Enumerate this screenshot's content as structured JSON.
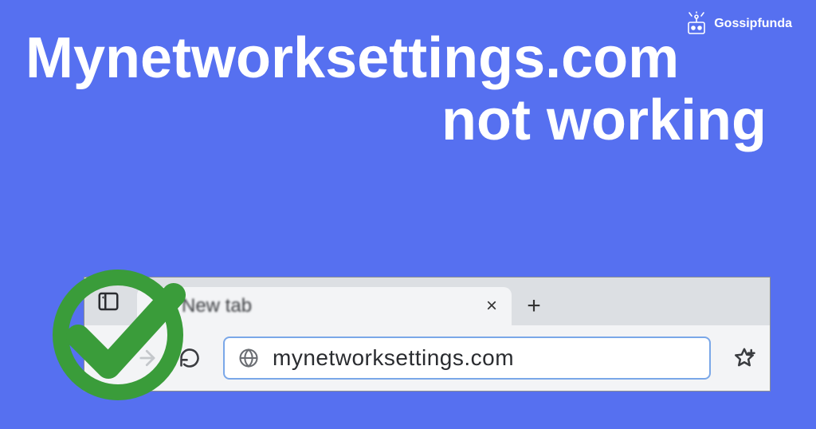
{
  "logo": {
    "text": "Gossipfunda"
  },
  "heading": {
    "line1": "Mynetworksettings.com",
    "line2": "not working"
  },
  "browser": {
    "tab": {
      "title": "New tab",
      "close": "×",
      "newtab": "+"
    },
    "address": {
      "url": "mynetworksettings.com"
    }
  },
  "colors": {
    "bg": "#5670f0",
    "check": "#3a9c3a"
  }
}
